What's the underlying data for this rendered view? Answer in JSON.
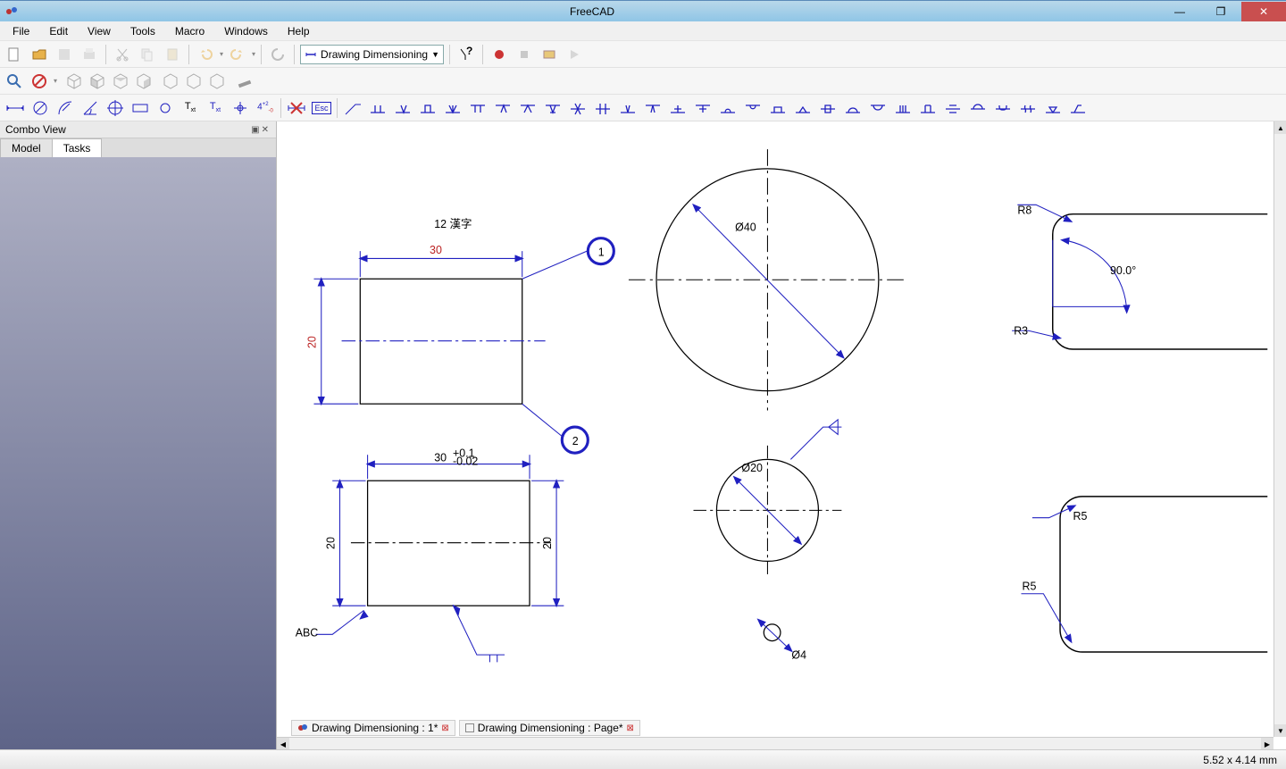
{
  "app": {
    "title": "FreeCAD"
  },
  "menu": [
    "File",
    "Edit",
    "View",
    "Tools",
    "Macro",
    "Windows",
    "Help"
  ],
  "workbench": "Drawing Dimensioning",
  "combo": {
    "title": "Combo View",
    "tabs": [
      "Model",
      "Tasks"
    ],
    "active": 1
  },
  "doctabs": [
    {
      "label": "Drawing Dimensioning : 1*"
    },
    {
      "label": "Drawing Dimensioning : Page*"
    }
  ],
  "status": {
    "coords": "5.52 x 4.14 mm"
  },
  "draw": {
    "note_top": "12  漢字",
    "dim30": "30",
    "dim20": "20",
    "balloon1": "1",
    "balloon2": "2",
    "dia40": "Ø40",
    "r8": "R8",
    "r3": "R3",
    "angle90": "90.0°",
    "dim30tol": "30",
    "tol_plus": "+0.1",
    "tol_minus": "-0.02",
    "dim20l": "20",
    "dim20r": "20",
    "abc": "ABC",
    "dia20": "Ø20",
    "dia4": "Ø4",
    "r5a": "R5",
    "r5b": "R5"
  }
}
